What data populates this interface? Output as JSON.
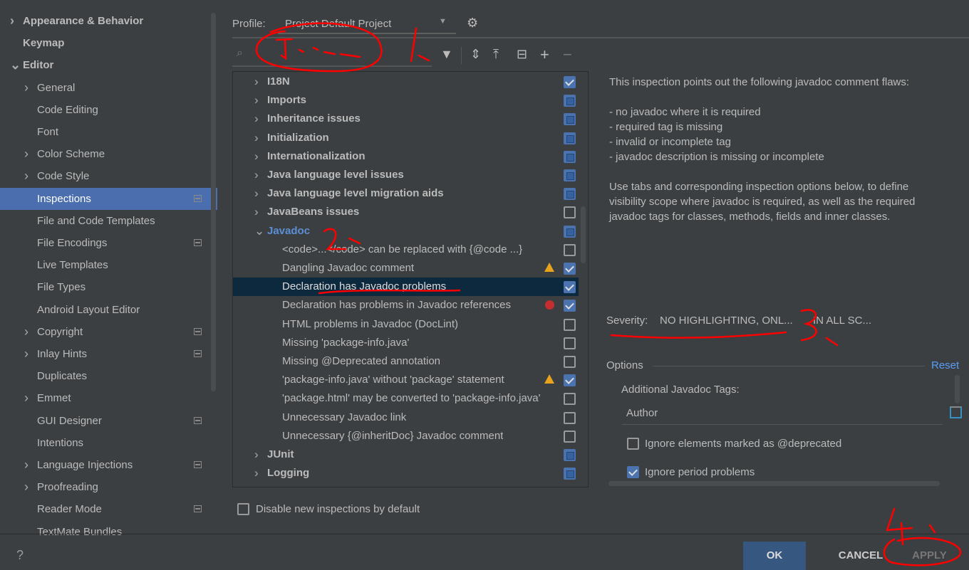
{
  "sidebar": {
    "items": [
      {
        "label": "Appearance & Behavior",
        "bold": true,
        "chevron": "right",
        "indent": 0
      },
      {
        "label": "Keymap",
        "bold": true,
        "indent": 0
      },
      {
        "label": "Editor",
        "bold": true,
        "chevron": "down",
        "indent": 0
      },
      {
        "label": "General",
        "chevron": "right",
        "indent": 1
      },
      {
        "label": "Code Editing",
        "indent": 1
      },
      {
        "label": "Font",
        "indent": 1
      },
      {
        "label": "Color Scheme",
        "chevron": "right",
        "indent": 1
      },
      {
        "label": "Code Style",
        "chevron": "right",
        "indent": 1
      },
      {
        "label": "Inspections",
        "indent": 1,
        "selected": true,
        "badge": true
      },
      {
        "label": "File and Code Templates",
        "indent": 1
      },
      {
        "label": "File Encodings",
        "indent": 1,
        "badge": true
      },
      {
        "label": "Live Templates",
        "indent": 1
      },
      {
        "label": "File Types",
        "indent": 1
      },
      {
        "label": "Android Layout Editor",
        "indent": 1
      },
      {
        "label": "Copyright",
        "chevron": "right",
        "indent": 1,
        "badge": true
      },
      {
        "label": "Inlay Hints",
        "chevron": "right",
        "indent": 1,
        "badge": true
      },
      {
        "label": "Duplicates",
        "indent": 1
      },
      {
        "label": "Emmet",
        "chevron": "right",
        "indent": 1
      },
      {
        "label": "GUI Designer",
        "indent": 1,
        "badge": true
      },
      {
        "label": "Intentions",
        "indent": 1
      },
      {
        "label": "Language Injections",
        "chevron": "right",
        "indent": 1,
        "badge": true
      },
      {
        "label": "Proofreading",
        "chevron": "right",
        "indent": 1
      },
      {
        "label": "Reader Mode",
        "indent": 1,
        "badge": true
      },
      {
        "label": "TextMate Bundles",
        "indent": 1
      }
    ]
  },
  "profile": {
    "label": "Profile:",
    "value": "Project Default  Project"
  },
  "search": {
    "value": "",
    "placeholder": ""
  },
  "toolbar": {
    "icons": [
      "filter-icon",
      "expand-all-icon",
      "collapse-all-icon",
      "reset-icon",
      "add-icon",
      "remove-icon"
    ]
  },
  "tree": {
    "rows": [
      {
        "label": "I18N",
        "type": "group",
        "check": "on"
      },
      {
        "label": "Imports",
        "type": "group",
        "check": "part"
      },
      {
        "label": "Inheritance issues",
        "type": "group",
        "check": "part"
      },
      {
        "label": "Initialization",
        "type": "group",
        "check": "part"
      },
      {
        "label": "Internationalization",
        "type": "group",
        "check": "part"
      },
      {
        "label": "Java language level issues",
        "type": "group",
        "check": "part"
      },
      {
        "label": "Java language level migration aids",
        "type": "group",
        "check": "part"
      },
      {
        "label": "JavaBeans issues",
        "type": "group",
        "check": "off"
      },
      {
        "label": "Javadoc",
        "type": "group",
        "expanded": true,
        "check": "part",
        "color": "#5c8ed6"
      },
      {
        "label": "<code>...</code> can be replaced with {@code ...}",
        "type": "leaf",
        "check": "off"
      },
      {
        "label": "Dangling Javadoc comment",
        "type": "leaf",
        "check": "on",
        "severity": "warning"
      },
      {
        "label": "Declaration has Javadoc problems",
        "type": "leaf",
        "check": "on",
        "selected": true
      },
      {
        "label": "Declaration has problems in Javadoc references",
        "type": "leaf",
        "check": "on",
        "severity": "error"
      },
      {
        "label": "HTML problems in Javadoc (DocLint)",
        "type": "leaf",
        "check": "off"
      },
      {
        "label": "Missing 'package-info.java'",
        "type": "leaf",
        "check": "off"
      },
      {
        "label": "Missing @Deprecated annotation",
        "type": "leaf",
        "check": "off"
      },
      {
        "label": "'package-info.java' without 'package' statement",
        "type": "leaf",
        "check": "on",
        "severity": "warning"
      },
      {
        "label": "'package.html' may be converted to 'package-info.java'",
        "type": "leaf",
        "check": "off"
      },
      {
        "label": "Unnecessary Javadoc link",
        "type": "leaf",
        "check": "off"
      },
      {
        "label": "Unnecessary {@inheritDoc} Javadoc comment",
        "type": "leaf",
        "check": "off"
      },
      {
        "label": "JUnit",
        "type": "group",
        "check": "part"
      },
      {
        "label": "Logging",
        "type": "group",
        "check": "part"
      }
    ]
  },
  "disable_new": {
    "label": "Disable new inspections by default",
    "checked": false
  },
  "description": {
    "intro": "This inspection points out the following javadoc comment flaws:",
    "bullets": [
      "- no javadoc where it is required",
      "- required tag is missing",
      "- invalid or incomplete tag",
      "- javadoc description is missing or incomplete"
    ],
    "para2_lines": [
      "Use tabs and corresponding inspection options below, to define",
      "visibility scope where javadoc is required, as well as the required",
      "javadoc tags for classes, methods, fields and inner classes."
    ]
  },
  "severity": {
    "label": "Severity:",
    "value": "NO HIGHLIGHTING, ONL...",
    "scope": "IN ALL SC..."
  },
  "options": {
    "title": "Options",
    "reset": "Reset",
    "tags_label": "Additional Javadoc Tags:",
    "tags_value": "Author",
    "ignore_deprecated": {
      "label": "Ignore elements marked as @deprecated",
      "checked": false
    },
    "ignore_period": {
      "label": "Ignore period problems",
      "checked": true
    }
  },
  "footer": {
    "help": "?",
    "ok": "OK",
    "cancel": "CANCEL",
    "apply": "APPLY"
  },
  "colors": {
    "accent": "#4b6eaf",
    "ok_button": "#365880",
    "annotation": "#ff0000",
    "selected_row": "#0d293e"
  },
  "annotations": [
    "1.",
    "2.",
    "3.",
    "4."
  ]
}
